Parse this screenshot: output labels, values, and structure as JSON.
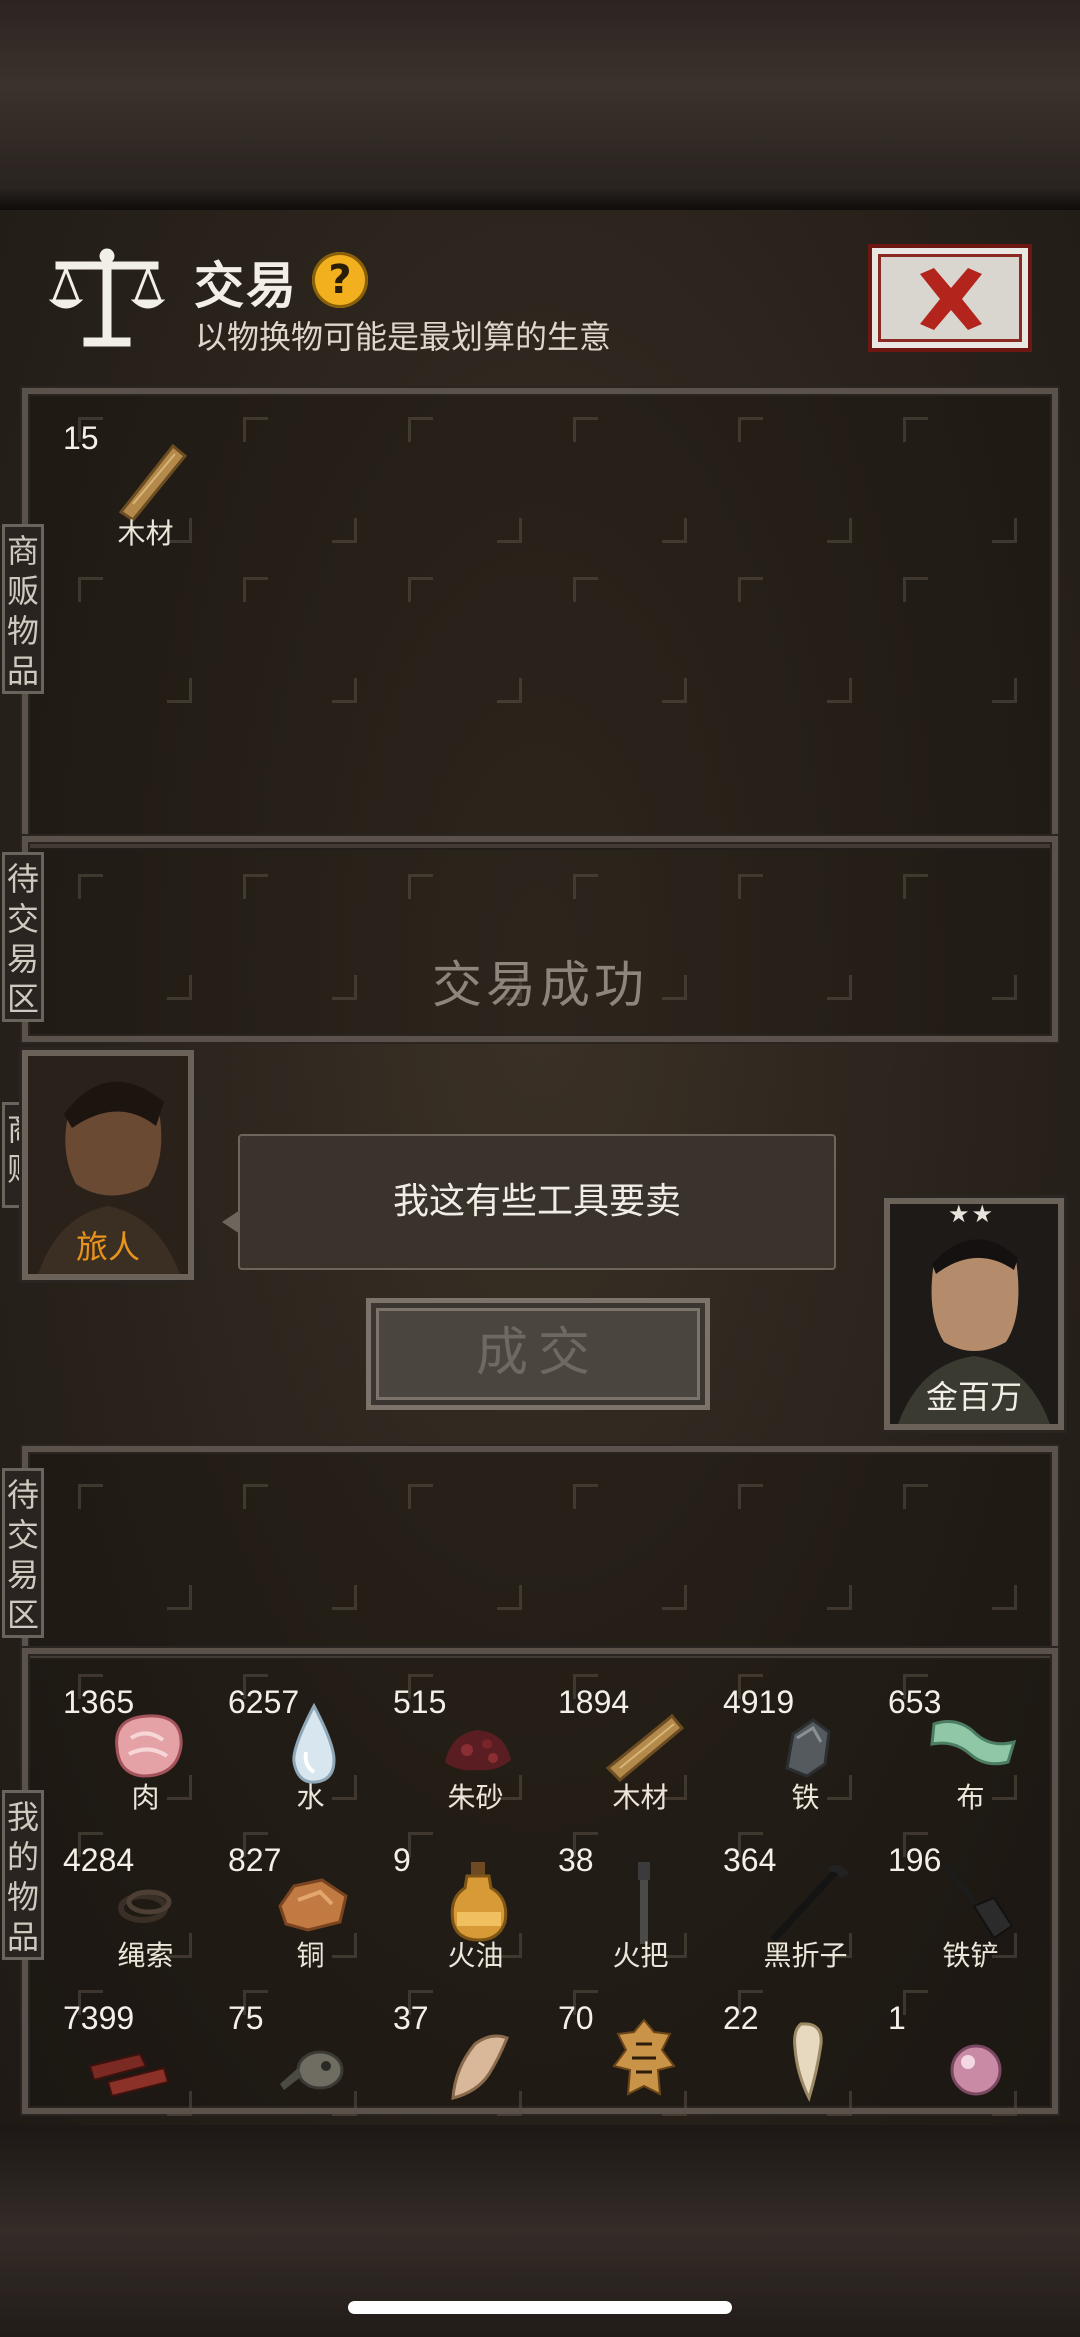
{
  "header": {
    "title": "交易",
    "help_icon": "?",
    "subtitle": "以物换物可能是最划算的生意",
    "scale_icon": "balance-scale-icon",
    "close_icon": "red-x-icon"
  },
  "merchant_goods": {
    "tab_label": "商贩物品",
    "items": [
      {
        "qty": "15",
        "name": "木材",
        "icon": "wood-plank-icon"
      }
    ]
  },
  "merchant_pending": {
    "tab_label": "待交易区",
    "status_text": "交易成功"
  },
  "merchant": {
    "tab_label": "商贩",
    "name": "旅人",
    "name_color": "#e8931c",
    "dialogue": "我这有些工具要卖"
  },
  "deal_button": {
    "label": "成交"
  },
  "player": {
    "name": "金百万",
    "stars": "★★"
  },
  "my_pending": {
    "tab_label": "待交易区"
  },
  "my_goods": {
    "tab_label": "我的物品",
    "items": [
      {
        "qty": "1365",
        "name": "肉",
        "icon": "meat-icon"
      },
      {
        "qty": "6257",
        "name": "水",
        "icon": "water-drop-icon"
      },
      {
        "qty": "515",
        "name": "朱砂",
        "icon": "cinnabar-icon"
      },
      {
        "qty": "1894",
        "name": "木材",
        "icon": "wood-plank-icon"
      },
      {
        "qty": "4919",
        "name": "铁",
        "icon": "iron-ore-icon"
      },
      {
        "qty": "653",
        "name": "布",
        "icon": "cloth-icon"
      },
      {
        "qty": "4284",
        "name": "绳索",
        "icon": "rope-icon"
      },
      {
        "qty": "827",
        "name": "铜",
        "icon": "copper-ore-icon"
      },
      {
        "qty": "9",
        "name": "火油",
        "icon": "oil-bottle-icon"
      },
      {
        "qty": "38",
        "name": "火把",
        "icon": "torch-icon"
      },
      {
        "qty": "364",
        "name": "黑折子",
        "icon": "black-stick-icon"
      },
      {
        "qty": "196",
        "name": "铁铲",
        "icon": "shovel-icon"
      },
      {
        "qty": "7399",
        "name": "",
        "icon": "jerky-icon"
      },
      {
        "qty": "75",
        "name": "",
        "icon": "gourd-flask-icon"
      },
      {
        "qty": "37",
        "name": "",
        "icon": "bone-horn-icon"
      },
      {
        "qty": "70",
        "name": "",
        "icon": "tiger-pelt-icon"
      },
      {
        "qty": "22",
        "name": "",
        "icon": "fang-icon"
      },
      {
        "qty": "1",
        "name": "",
        "icon": "pearl-icon"
      }
    ]
  }
}
